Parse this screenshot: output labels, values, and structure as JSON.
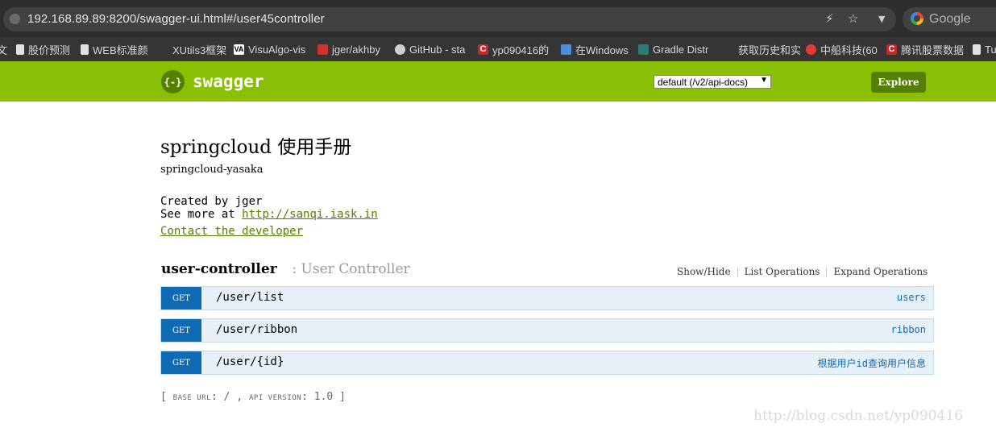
{
  "browser": {
    "url": "192.168.89.89:8200/swagger-ui.html#/user45controller",
    "search_engine": "Google",
    "bookmarks": [
      {
        "label": "文",
        "color": "#9e9e9e"
      },
      {
        "label": "股价预测",
        "color": "#e0e0e0"
      },
      {
        "label": "WEB标准颜",
        "color": "#e0e0e0"
      },
      {
        "label": "XUtils3框架",
        "color": "#353535"
      },
      {
        "label": "VisuAlgo-vis",
        "color": "#ffffff"
      },
      {
        "label": "jger/akhby",
        "color": "#d32f2f"
      },
      {
        "label": "GitHub - sta",
        "color": "#cfcfcf"
      },
      {
        "label": "yp090416的",
        "color": "#c62828"
      },
      {
        "label": "在Windows",
        "color": "#4a90d9"
      },
      {
        "label": "Gradle Distr",
        "color": "#2e7d6b"
      },
      {
        "label": "获取历史和实",
        "color": "#353535"
      },
      {
        "label": "中船科技(60",
        "color": "#e53935"
      },
      {
        "label": "腾讯股票数据",
        "color": "#c62828"
      },
      {
        "label": "Tu",
        "color": "#e0e0e0"
      }
    ]
  },
  "header": {
    "logo_text": "{-}",
    "title": "swagger",
    "select_value": "default (/v2/api-docs)",
    "explore_label": "Explore"
  },
  "info": {
    "title": "springcloud 使用手册",
    "description": "springcloud-yasaka",
    "created_by": "Created by jger",
    "see_more_prefix": "See more at ",
    "see_more_link": "http://sanqi.iask.in",
    "contact": "Contact the developer"
  },
  "resource": {
    "name": "user-controller",
    "separator": " : ",
    "description": "User Controller",
    "links": [
      "Show/Hide",
      "List Operations",
      "Expand Operations"
    ],
    "operations": [
      {
        "method": "GET",
        "path": "/user/list",
        "summary": "users"
      },
      {
        "method": "GET",
        "path": "/user/ribbon",
        "summary": "ribbon"
      },
      {
        "method": "GET",
        "path": "/user/{id}",
        "summary": "根据用户id查询用户信息"
      }
    ]
  },
  "footer": {
    "open_bracket": "[",
    "base_url_label": "BASE URL",
    "base_url_value": ": / , ",
    "api_version_label": "API VERSION",
    "api_version_value": ": 1.0 ",
    "close_bracket": "]"
  },
  "watermark": "http://blog.csdn.net/yp090416"
}
